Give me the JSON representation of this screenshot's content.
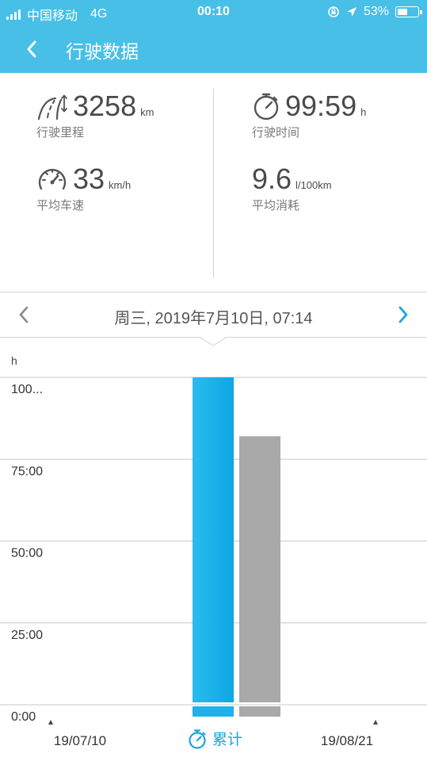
{
  "status_bar": {
    "carrier": "中国移动",
    "network": "4G",
    "time": "00:10",
    "battery_text": "53%",
    "battery_level": 0.53
  },
  "header": {
    "title": "行驶数据"
  },
  "stats": {
    "distance": {
      "value": "3258",
      "unit": "km",
      "label": "行驶里程"
    },
    "duration": {
      "value": "99:59",
      "unit": "h",
      "label": "行驶时间"
    },
    "speed": {
      "value": "33",
      "unit": "km/h",
      "label": "平均车速"
    },
    "consumption": {
      "value": "9.6",
      "unit": "l/100km",
      "label": "平均消耗"
    }
  },
  "date_nav": {
    "current": "周三, 2019年7月10日, 07:14"
  },
  "footer": {
    "legend_label": "累计"
  },
  "colors": {
    "header": "#48bfe7",
    "accent": "#1aa5de",
    "bar_selected": "#1eb2e8",
    "bar_other": "#a9a9a9"
  },
  "chart_data": {
    "type": "bar",
    "ylabel": "h",
    "ylim": [
      0,
      100
    ],
    "yticks": [
      0,
      25,
      50,
      75,
      100
    ],
    "ytick_labels": [
      "0:00",
      "25:00",
      "50:00",
      "75:00",
      "100..."
    ],
    "categories": [
      "19/07/10",
      "19/08/21"
    ],
    "x_labels": [
      "19/07/10",
      "19/08/21"
    ],
    "series": [
      {
        "values": [
          100,
          82
        ]
      }
    ],
    "selected_index": 0,
    "grid": true
  }
}
